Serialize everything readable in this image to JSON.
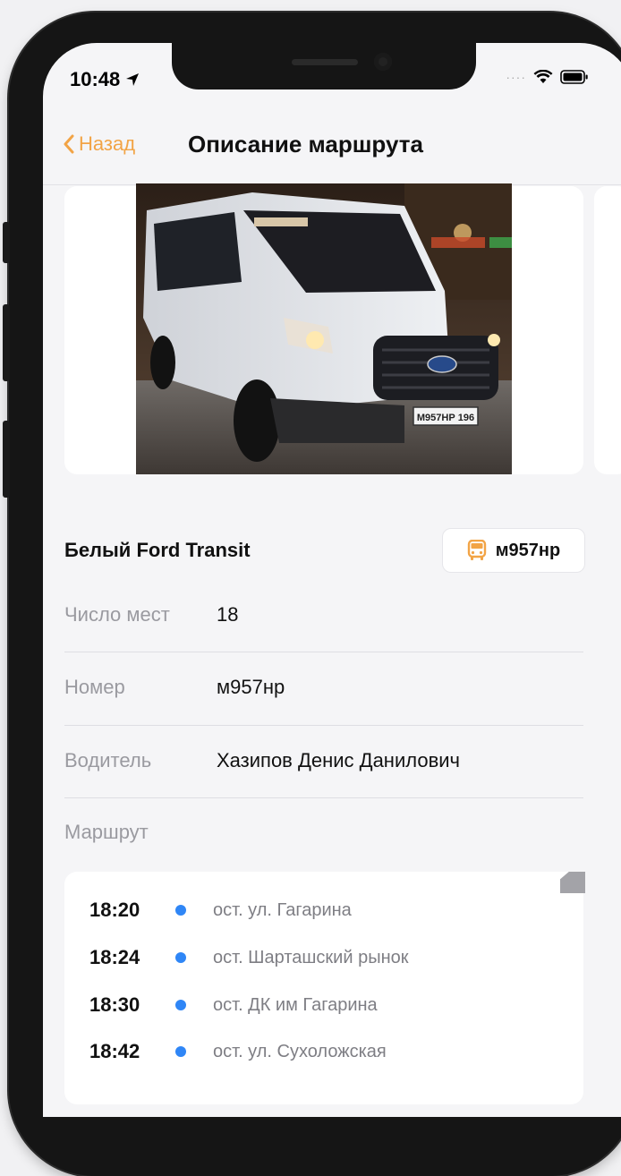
{
  "status": {
    "time": "10:48"
  },
  "nav": {
    "back_label": "Назад",
    "title": "Описание маршрута"
  },
  "vehicle": {
    "title": "Белый Ford Transit",
    "plate": "м957нр",
    "photo_plate": "М957НР 196"
  },
  "details": [
    {
      "label": "Число мест",
      "value": "18"
    },
    {
      "label": "Номер",
      "value": "м957нр"
    },
    {
      "label": "Водитель",
      "value": "Хазипов Денис Данилович"
    }
  ],
  "route": {
    "label": "Маршрут",
    "stops": [
      {
        "time": "18:20",
        "name": "ост. ул. Гагарина"
      },
      {
        "time": "18:24",
        "name": "ост. Шарташский рынок"
      },
      {
        "time": "18:30",
        "name": "ост. ДК им Гагарина"
      },
      {
        "time": "18:42",
        "name": "ост. ул. Сухоложская"
      }
    ]
  },
  "colors": {
    "accent": "#f2a446",
    "stop_dot": "#2f86f6"
  }
}
